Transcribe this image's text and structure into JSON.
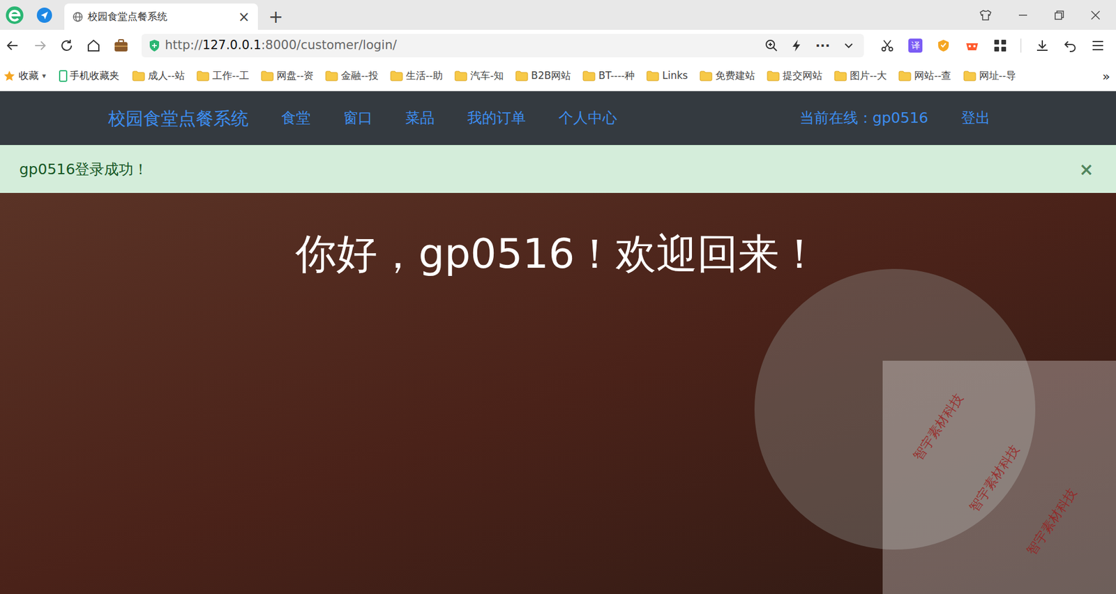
{
  "browser": {
    "tab": {
      "title": "校园食堂点餐系统",
      "close": "×"
    },
    "new_tab": "+"
  },
  "address": {
    "scheme": "http://",
    "host": "127.0.0.1",
    "path": ":8000/customer/login/",
    "more": "···",
    "translate": "译"
  },
  "bookmarks": {
    "favorites": "收藏",
    "dropdown": "▾",
    "mobile": "手机收藏夹",
    "items": [
      "成人--站",
      "工作--工",
      "网盘--资",
      "金融--投",
      "生活--助",
      "汽车-知",
      "B2B网站",
      "BT----种",
      "Links",
      "免费建站",
      "提交网站",
      "图片--大",
      "网站--查",
      "网址--导"
    ],
    "overflow": "»"
  },
  "navbar": {
    "brand": "校园食堂点餐系统",
    "links": [
      "食堂",
      "窗口",
      "菜品",
      "我的订单",
      "个人中心"
    ],
    "online": "当前在线：gp0516",
    "logout": "登出"
  },
  "alert": {
    "message": "gp0516登录成功！",
    "close": "×"
  },
  "hero": {
    "greeting": "你好，gp0516！欢迎回来！"
  },
  "watermark": [
    "智宇素材科技",
    "智宇素材科技",
    "智宇素材科技"
  ]
}
